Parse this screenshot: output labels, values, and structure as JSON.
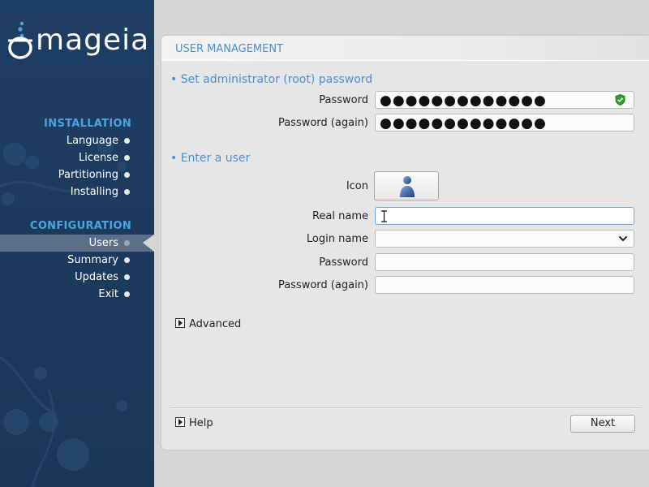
{
  "brand": {
    "logo_text": "mageia"
  },
  "sidebar": {
    "installation_heading": "INSTALLATION",
    "installation_items": [
      {
        "label": "Language"
      },
      {
        "label": "License"
      },
      {
        "label": "Partitioning"
      },
      {
        "label": "Installing"
      }
    ],
    "configuration_heading": "CONFIGURATION",
    "configuration_items": [
      {
        "label": "Users",
        "active": true
      },
      {
        "label": "Summary"
      },
      {
        "label": "Updates"
      },
      {
        "label": "Exit"
      }
    ]
  },
  "panel": {
    "title": "USER MANAGEMENT",
    "root_section": {
      "heading": "• Set administrator (root) password",
      "password_label": "Password",
      "password_value": "●●●●●●●●●●●●●",
      "password_again_label": "Password (again)",
      "password_again_value": "●●●●●●●●●●●●●"
    },
    "user_section": {
      "heading": "• Enter a user",
      "icon_label": "Icon",
      "real_name_label": "Real name",
      "real_name_value": "",
      "login_name_label": "Login name",
      "login_name_value": "",
      "password_label": "Password",
      "password_value": "",
      "password_again_label": "Password (again)",
      "password_again_value": ""
    },
    "advanced_label": "Advanced",
    "help_label": "Help",
    "next_label": "Next"
  },
  "colors": {
    "sidebar_bg": "#1c3a5d",
    "accent_heading": "#4da3e0",
    "section_heading": "#4a8fd6",
    "shield_green": "#2e9e2e"
  },
  "icons": {
    "strength": "shield-check-icon",
    "user_avatar": "user-icon",
    "dropdown": "chevron-down-icon",
    "expander": "expander-triangle-icon"
  }
}
